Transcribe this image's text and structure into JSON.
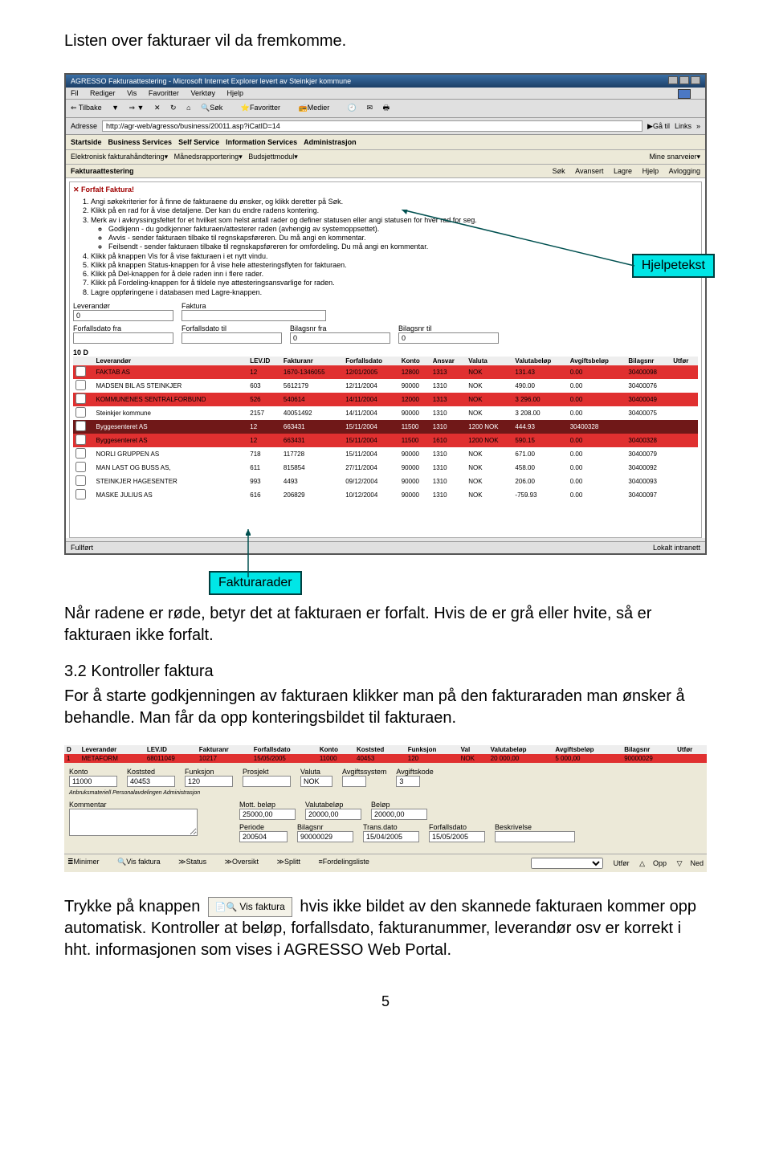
{
  "intro_text": "Listen over fakturaer vil da fremkomme.",
  "callout_help": "Hjelpetekst",
  "callout_rows": "Fakturarader",
  "browser": {
    "title": "AGRESSO Fakturaattestering - Microsoft Internet Explorer levert av Steinkjer kommune",
    "menus": [
      "Fil",
      "Rediger",
      "Vis",
      "Favoritter",
      "Verktøy",
      "Hjelp"
    ],
    "tb_back": "Tilbake",
    "tb_search": "Søk",
    "tb_fav": "Favoritter",
    "tb_media": "Medier",
    "addr_label": "Adresse",
    "addr_value": "http://agr-web/agresso/business/20011.asp?iCatID=14",
    "go": "Gå til",
    "links": "Links",
    "status_left": "Fullført",
    "status_right": "Lokalt intranett"
  },
  "topnav_items": [
    "Startside",
    "Business Services",
    "Self Service",
    "Information Services",
    "Administrasjon"
  ],
  "subnav_left": [
    "Elektronisk fakturahåndtering",
    "Månedsrapportering",
    "Budsjettmodul"
  ],
  "subnav_right": "Mine snarveier",
  "crumb": "Fakturaattestering",
  "actions_right": [
    "Søk",
    "Avansert",
    "Lagre",
    "Hjelp",
    "Avlogging"
  ],
  "panel_title": "✕  Forfalt Faktura!",
  "help_items": [
    "Angi søkekriterier for å finne de fakturaene du ønsker, og klikk deretter på Søk.",
    "Klikk på en rad for å vise detaljene. Der kan du endre radens kontering.",
    "Merk av i avkryssingsfeltet for et hvilket som helst antall rader og definer statusen eller angi statusen for hver rad for seg."
  ],
  "help_sub": [
    "Godkjenn - du godkjenner fakturaen/attesterer raden (avhengig av systemoppsettet).",
    "Avvis - sender fakturaen tilbake til regnskapsføreren. Du må angi en kommentar.",
    "Feilsendt - sender fakturaen tilbake til regnskapsføreren for omfordeling. Du må angi en kommentar."
  ],
  "help_items2": [
    "Klikk på knappen Vis for å vise fakturaen i et nytt vindu.",
    "Klikk på knappen Status-knappen for å vise hele attesteringsflyten for fakturaen.",
    "Klikk på Del-knappen for å dele raden inn i flere rader.",
    "Klikk på Fordeling-knappen for å tildele nye attesteringsansvarlige for raden.",
    "Lagre oppføringene i databasen med Lagre-knappen."
  ],
  "search": {
    "lev_lbl": "Leverandør",
    "lev_val": "0",
    "fak_lbl": "Faktura",
    "fak_val": "",
    "fra_lbl": "Forfallsdato fra",
    "fra_val": "",
    "til_lbl": "Forfallsdato til",
    "til_val": "",
    "bfra_lbl": "Bilagsnr fra",
    "bfra_val": "0",
    "btil_lbl": "Bilagsnr til",
    "btil_val": "0",
    "count": "10 D"
  },
  "cols": [
    "Leverandør",
    "LEV.ID",
    "Fakturanr",
    "Forfallsdato",
    "Konto",
    "Ansvar",
    "Valuta",
    "Valutabeløp",
    "Avgiftsbeløp",
    "Bilagsnr",
    "Utfør"
  ],
  "rows": [
    {
      "red": true,
      "c": [
        "FAKTAB AS",
        "12",
        "1670-1346055",
        "12/01/2005",
        "12800",
        "1313",
        "NOK",
        "131.43",
        "0.00",
        "30400098",
        ""
      ]
    },
    {
      "red": false,
      "c": [
        "MADSEN BIL AS STEINKJER",
        "603",
        "5612179",
        "12/11/2004",
        "90000",
        "1310",
        "NOK",
        "490.00",
        "0.00",
        "30400076",
        ""
      ]
    },
    {
      "red": true,
      "c": [
        "KOMMUNENES SENTRALFORBUND",
        "526",
        "540614",
        "14/11/2004",
        "12000",
        "1313",
        "NOK",
        "3 296.00",
        "0.00",
        "30400049",
        ""
      ]
    },
    {
      "red": false,
      "c": [
        "Steinkjer kommune",
        "2157",
        "40051492",
        "14/11/2004",
        "90000",
        "1310",
        "NOK",
        "3 208.00",
        "0.00",
        "30400075",
        ""
      ]
    },
    {
      "red": true,
      "drk": true,
      "c": [
        "Byggesenteret AS",
        "12",
        "663431",
        "15/11/2004",
        "11500",
        "1310",
        "1200 NOK",
        "444.93",
        "30400328",
        "",
        ""
      ]
    },
    {
      "red": true,
      "c": [
        "Byggesenteret AS",
        "12",
        "663431",
        "15/11/2004",
        "11500",
        "1610",
        "1200 NOK",
        "590.15",
        "0.00",
        "30400328",
        ""
      ]
    },
    {
      "red": false,
      "c": [
        "NORLI GRUPPEN AS",
        "718",
        "117728",
        "15/11/2004",
        "90000",
        "1310",
        "NOK",
        "671.00",
        "0.00",
        "30400079",
        ""
      ]
    },
    {
      "red": false,
      "c": [
        "MAN LAST OG BUSS AS,",
        "611",
        "815854",
        "27/11/2004",
        "90000",
        "1310",
        "NOK",
        "458.00",
        "0.00",
        "30400092",
        ""
      ]
    },
    {
      "red": false,
      "c": [
        "STEINKJER HAGESENTER",
        "993",
        "4493",
        "09/12/2004",
        "90000",
        "1310",
        "NOK",
        "206.00",
        "0.00",
        "30400093",
        ""
      ]
    },
    {
      "red": false,
      "c": [
        "MASKE JULIUS AS",
        "616",
        "206829",
        "10/12/2004",
        "90000",
        "1310",
        "NOK",
        "-759.93",
        "0.00",
        "30400097",
        ""
      ]
    }
  ],
  "body_after_rows": "Når radene er røde, betyr det at fakturaen er forfalt. Hvis de er grå eller hvite, så er fakturaen ikke forfalt.",
  "h32": "3.2 Kontroller faktura",
  "body32": "For å starte godkjenningen av fakturaen klikker man på den fakturaraden man ønsker å behandle. Man får da opp konteringsbildet til fakturaen.",
  "detail": {
    "cols": [
      "D",
      "Leverandør",
      "LEV.ID",
      "Fakturanr",
      "Forfallsdato",
      "Konto",
      "Koststed",
      "Funksjon",
      "Val",
      "Valutabeløp",
      "Avgiftsbeløp",
      "Bilagsnr",
      "Utfør"
    ],
    "row": [
      "1",
      "METAFORM",
      "68011049",
      "10217",
      "15/05/2005",
      "11000",
      "40453",
      "120",
      "NOK",
      "20 000,00",
      "5 000,00",
      "90000029",
      ""
    ],
    "konto_l": "Konto",
    "konto_v": "11000",
    "kost_l": "Koststed",
    "kost_v": "40453",
    "funk_l": "Funksjon",
    "funk_v": "120",
    "prosj_l": "Prosjekt",
    "prosj_v": "",
    "valuta_l": "Valuta",
    "valuta_v": "NOK",
    "avgsys_l": "Avgiftssystem",
    "avgsys_v": "",
    "avgkode_l": "Avgiftskode",
    "avgkode_v": "3",
    "tinyh": "Anbruksmateriell   Personalavdelingen   Administrasjon",
    "komm_l": "Kommentar",
    "komm_v": "",
    "mott_l": "Mott. beløp",
    "mott_v": "25000,00",
    "valbel_l": "Valutabeløp",
    "valbel_v": "20000,00",
    "bel_l": "Beløp",
    "bel_v": "20000,00",
    "per_l": "Periode",
    "per_v": "200504",
    "bil_l": "Bilagsnr",
    "bil_v": "90000029",
    "trd_l": "Trans.dato",
    "trd_v": "15/04/2005",
    "forf_l": "Forfallsdato",
    "forf_v": "15/05/2005",
    "besk_l": "Beskrivelse",
    "besk_v": "",
    "tb_left": [
      "Minimer",
      "Vis faktura",
      "Status",
      "Oversikt",
      "Splitt",
      "Fordelingsliste"
    ],
    "tb_right": [
      "Utfør",
      "Opp",
      "Ned"
    ]
  },
  "inline_btn_label": "Vis faktura",
  "body_last_a": "Trykke på knappen",
  "body_last_b": "hvis ikke bildet av den skannede fakturaen kommer opp automatisk. Kontroller at beløp, forfallsdato, fakturanummer, leverandør osv er korrekt i hht. informasjonen som vises i AGRESSO Web Portal.",
  "page_no": "5"
}
